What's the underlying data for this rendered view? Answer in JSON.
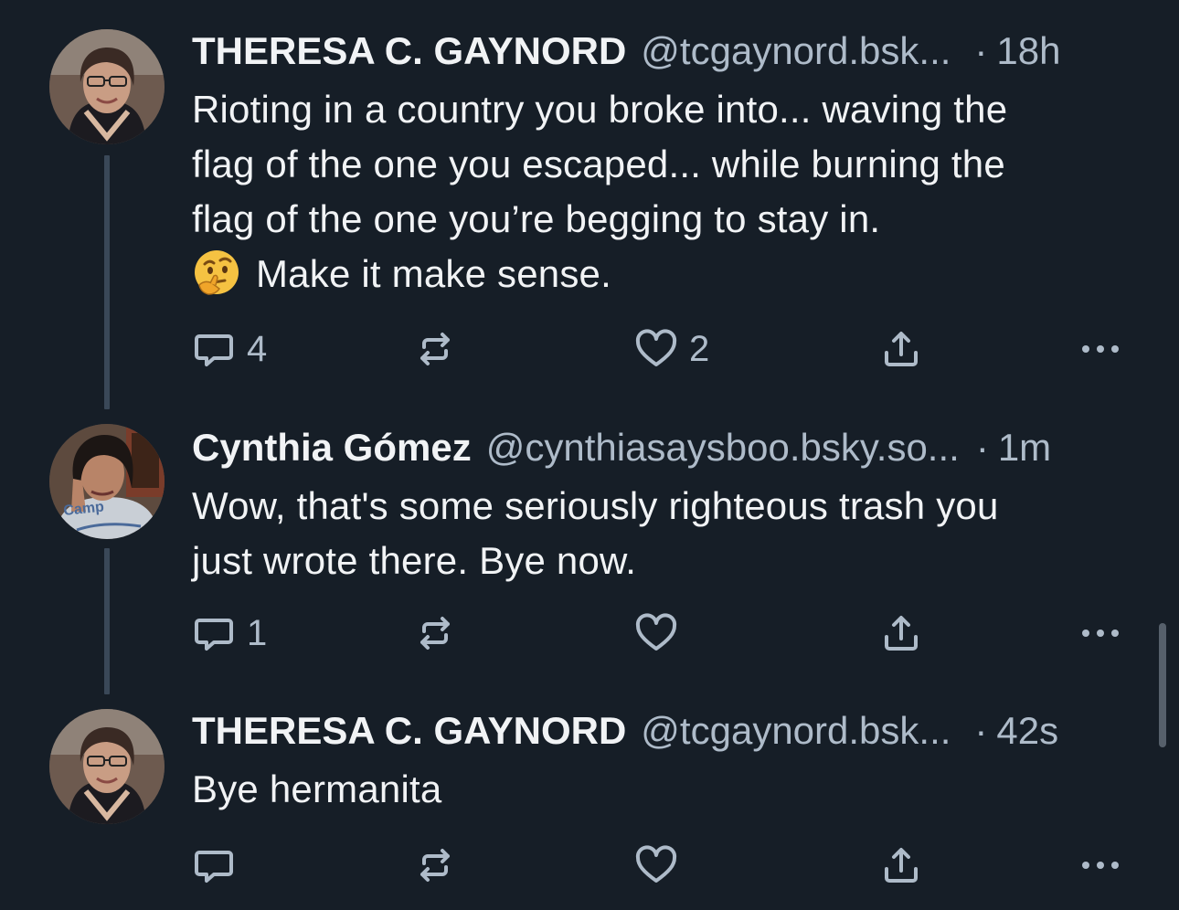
{
  "posts": [
    {
      "author_name": "THERESA C. GAYNORD",
      "handle": "@tcgaynord.bsk...",
      "separator": "·",
      "time": "18h",
      "emoji": "🤔",
      "text_lines": [
        "Rioting in a country you broke into... waving the",
        "flag of the one you escaped... while burning the",
        "flag of the one you’re begging to stay in."
      ],
      "text_last": "Make it make sense.",
      "reply_count": "4",
      "repost_count": "",
      "like_count": "2",
      "icons": [
        "reply-icon",
        "repost-icon",
        "like-icon",
        "share-icon",
        "more-icon"
      ]
    },
    {
      "author_name": "Cynthia Gómez",
      "handle": "@cynthiasaysboo.bsky.so...",
      "separator": "·",
      "time": "1m",
      "text": "Wow, that's some seriously righteous trash you\njust wrote there. Bye now.",
      "reply_count": "1",
      "repost_count": "",
      "like_count": "",
      "icons": [
        "reply-icon",
        "repost-icon",
        "like-icon",
        "share-icon",
        "more-icon"
      ],
      "avatar_shirt_text": "Camp"
    },
    {
      "author_name": "THERESA C. GAYNORD",
      "handle": "@tcgaynord.bsk...",
      "separator": "·",
      "time": "42s",
      "text": "Bye hermanita",
      "reply_count": "",
      "repost_count": "",
      "like_count": "",
      "icons": [
        "reply-icon",
        "repost-icon",
        "like-icon",
        "share-icon",
        "more-icon"
      ]
    }
  ],
  "colors": {
    "background": "#161e27",
    "text_primary": "#f1f3f5",
    "text_secondary": "#aebbc9",
    "thread_line": "#3a4858"
  }
}
